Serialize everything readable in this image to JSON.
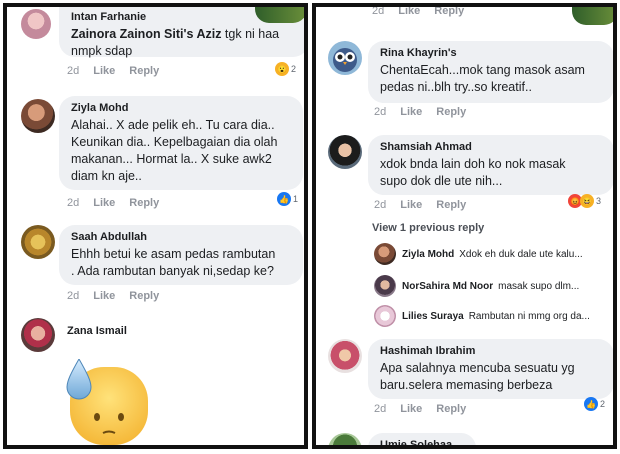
{
  "left": {
    "c1": {
      "name": "Intan Farhanie",
      "mention": "Zainora Zainon Siti's Aziz",
      "text": " tgk ni haa\nnmpk sdap",
      "time": "2d",
      "like": "Like",
      "reply": "Reply",
      "react_count": "2"
    },
    "c2": {
      "name": "Ziyla Mohd",
      "text": "Alahai.. X ade pelik eh.. Tu cara dia..\nKeunikan dia.. Kepelbagaian dia olah\nmakanan... Hormat la.. X suke awk2\ndiam kn aje..",
      "time": "2d",
      "like": "Like",
      "reply": "Reply",
      "react_count": "1"
    },
    "c3": {
      "name": "Saah Abdullah",
      "text": "Ehhh betui ke asam pedas rambutan\n. Ada rambutan banyak ni,sedap ke?",
      "time": "2d",
      "like": "Like",
      "reply": "Reply"
    },
    "c4": {
      "name": "Zana Ismail"
    },
    "top_meta": {
      "time": "2d",
      "like": "Like",
      "reply": "Reply"
    }
  },
  "right": {
    "top_meta": {
      "time": "2d",
      "like": "Like",
      "reply": "Reply"
    },
    "c1": {
      "name": "Rina Khayrin's",
      "text": "ChentaEcah...mok tang masok asam\npedas ni..blh try..so kreatif..",
      "time": "2d",
      "like": "Like",
      "reply": "Reply"
    },
    "c2": {
      "name": "Shamsiah Ahmad",
      "text": "xdok bnda lain doh ko nok masak\nsupo dok dle ute nih...",
      "time": "2d",
      "like": "Like",
      "reply": "Reply",
      "react_count": "3"
    },
    "view_previous": "View 1 previous reply",
    "replies": [
      {
        "name": "Ziyla Mohd",
        "text": "Xdok eh duk dale ute kalu..."
      },
      {
        "name": "NorSahira Md Noor",
        "text": "masak supo dlm..."
      },
      {
        "name": "Lilies Suraya",
        "text": "Rambutan ni mmg org da..."
      }
    ],
    "c3": {
      "name": "Hashimah Ibrahim",
      "text": "Apa salahnya mencuba sesuatu yg\nbaru.selera memasing berbeza",
      "time": "2d",
      "like": "Like",
      "reply": "Reply",
      "react_count": "2"
    },
    "c4": {
      "name": "Umie Solehaa"
    }
  },
  "colors": {
    "bubble": "#eef0f3",
    "meta": "#90949c",
    "like_blue": "#1877f2",
    "border": "#111111"
  }
}
